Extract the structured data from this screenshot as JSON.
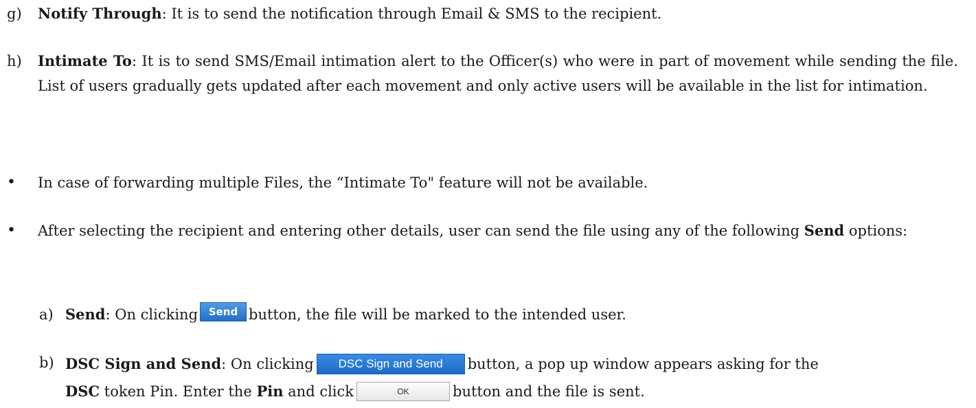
{
  "items": {
    "g": {
      "marker": "g)",
      "term": "Notify Through",
      "text": ": It is to send the notification through Email & SMS to the recipient."
    },
    "h": {
      "marker": "h)",
      "term": "Intimate To",
      "text": ":  It is to send SMS/Email intimation alert to the Officer(s) who were in part of movement while sending the file. List of users gradually gets updated after each movement and only active users will be available in the list for intimation."
    }
  },
  "bullets": {
    "dot": "•",
    "b1": "In case of forwarding multiple Files, the “Intimate To\" feature will not be available.",
    "b2_pre": "After selecting the recipient and entering other details, user can send the file using any of the following ",
    "b2_term": "Send",
    "b2_post": " options:"
  },
  "send_options": {
    "a": {
      "marker": "a)",
      "term": "Send",
      "pre": ": On clicking",
      "button": "Send",
      "post": "button, the file will be marked to the intended user."
    },
    "b": {
      "marker": "b)",
      "term": "DSC Sign and Send",
      "pre": ": On clicking",
      "button": "DSC Sign and Send",
      "post": "button, a pop up window appears asking for the",
      "line2_term1": "DSC",
      "line2_mid": " token Pin. Enter the ",
      "line2_term2": "Pin",
      "line2_pre_btn": " and click",
      "ok_button": "OK",
      "line2_post": "button and the file is sent."
    }
  },
  "colors": {
    "primary_button": "#1f6fce",
    "secondary_button": "#e6e6e6"
  }
}
